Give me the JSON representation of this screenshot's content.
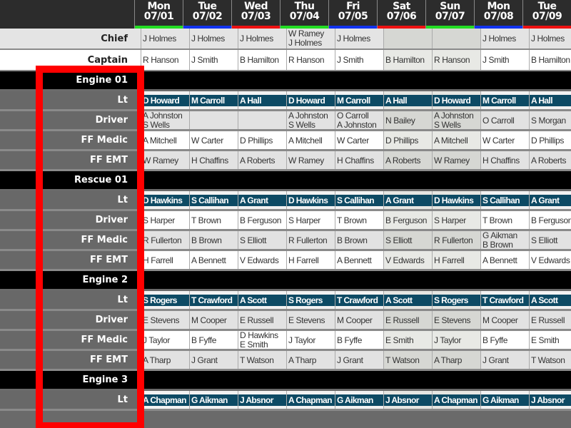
{
  "days": [
    {
      "dow": "Mon",
      "date": "07/01",
      "color": "#22dd22",
      "weekend": false
    },
    {
      "dow": "Tue",
      "date": "07/02",
      "color": "#1133ee",
      "weekend": false
    },
    {
      "dow": "Wed",
      "date": "07/03",
      "color": "#ee1111",
      "weekend": false
    },
    {
      "dow": "Thu",
      "date": "07/04",
      "color": "#22dd22",
      "weekend": false
    },
    {
      "dow": "Fri",
      "date": "07/05",
      "color": "#1133ee",
      "weekend": false
    },
    {
      "dow": "Sat",
      "date": "07/06",
      "color": "#ee1111",
      "weekend": true
    },
    {
      "dow": "Sun",
      "date": "07/07",
      "color": "#22dd22",
      "weekend": true
    },
    {
      "dow": "Mon",
      "date": "07/08",
      "color": "#1133ee",
      "weekend": false
    },
    {
      "dow": "Tue",
      "date": "07/09",
      "color": "#ee1111",
      "weekend": false
    }
  ],
  "top_rows": [
    {
      "label": "Chief",
      "kind": "chief",
      "cells": [
        "J Holmes",
        "J Holmes",
        "J Holmes",
        "W Ramey\nJ Holmes",
        "J Holmes",
        "",
        "",
        "J Holmes",
        "J Holmes"
      ]
    },
    {
      "label": "Captain",
      "kind": "captain",
      "cells": [
        "R Hanson",
        "J Smith",
        "B Hamilton",
        "R Hanson",
        "J Smith",
        "B Hamilton",
        "R Hanson",
        "J Smith",
        "B Hamilton"
      ]
    }
  ],
  "units": [
    {
      "name": "Engine 01",
      "positions": [
        {
          "label": "Lt",
          "cells": [
            "D Howard",
            "M Carroll",
            "A Hall",
            "D Howard",
            "M Carroll",
            "A Hall",
            "D Howard",
            "M Carroll",
            "A Hall"
          ]
        },
        {
          "label": "Driver",
          "cells": [
            "A Johnston\nS Wells",
            "",
            "",
            "A Johnston\nS Wells",
            "O Carroll\nA Johnston",
            "N Bailey",
            "A Johnston\nS Wells",
            "O Carroll",
            "S Morgan"
          ]
        },
        {
          "label": "FF Medic",
          "cells": [
            "A Mitchell",
            "W Carter",
            "D Phillips",
            "A Mitchell",
            "W Carter",
            "D Phillips",
            "A Mitchell",
            "W Carter",
            "D Phillips"
          ]
        },
        {
          "label": "FF EMT",
          "cells": [
            "W Ramey",
            "H Chaffins",
            "A Roberts",
            "W Ramey",
            "H Chaffins",
            "A Roberts",
            "W Ramey",
            "H Chaffins",
            "A Roberts"
          ]
        }
      ]
    },
    {
      "name": "Rescue 01",
      "positions": [
        {
          "label": "Lt",
          "cells": [
            "D Hawkins",
            "S Callihan",
            "A Grant",
            "D Hawkins",
            "S Callihan",
            "A Grant",
            "D Hawkins",
            "S Callihan",
            "A Grant"
          ]
        },
        {
          "label": "Driver",
          "cells": [
            "S Harper",
            "T Brown",
            "B Ferguson",
            "S Harper",
            "T Brown",
            "B Ferguson",
            "S Harper",
            "T Brown",
            "B Ferguson"
          ]
        },
        {
          "label": "FF Medic",
          "cells": [
            "R Fullerton",
            "B Brown",
            "S Elliott",
            "R Fullerton",
            "B Brown",
            "S Elliott",
            "R Fullerton",
            "G Aikman\nB Brown",
            "S Elliott"
          ]
        },
        {
          "label": "FF EMT",
          "cells": [
            "H Farrell",
            "A Bennett",
            "V Edwards",
            "H Farrell",
            "A Bennett",
            "V Edwards",
            "H Farrell",
            "A Bennett",
            "V Edwards"
          ]
        }
      ]
    },
    {
      "name": "Engine 2",
      "positions": [
        {
          "label": "Lt",
          "cells": [
            "S Rogers",
            "T Crawford",
            "A Scott",
            "S Rogers",
            "T Crawford",
            "A Scott",
            "S Rogers",
            "T Crawford",
            "A Scott"
          ]
        },
        {
          "label": "Driver",
          "cells": [
            "E Stevens",
            "M Cooper",
            "E Russell",
            "E Stevens",
            "M Cooper",
            "E Russell",
            "E Stevens",
            "M Cooper",
            "E Russell"
          ]
        },
        {
          "label": "FF Medic",
          "cells": [
            "J Taylor",
            "B Fyffe",
            "D Hawkins\nE Smith",
            "J Taylor",
            "B Fyffe",
            "E Smith",
            "J Taylor",
            "B Fyffe",
            "E Smith"
          ]
        },
        {
          "label": "FF EMT",
          "cells": [
            "A Tharp",
            "J Grant",
            "T Watson",
            "A Tharp",
            "J Grant",
            "T Watson",
            "A Tharp",
            "J Grant",
            "T Watson"
          ]
        }
      ]
    },
    {
      "name": "Engine 3",
      "positions": [
        {
          "label": "Lt",
          "cells": [
            "A Chapman",
            "G Aikman",
            "J Absnor",
            "A Chapman",
            "G Aikman",
            "J Absnor",
            "A Chapman",
            "G Aikman",
            "J Absnor"
          ]
        }
      ]
    }
  ],
  "highlight_color": "#ff0000"
}
